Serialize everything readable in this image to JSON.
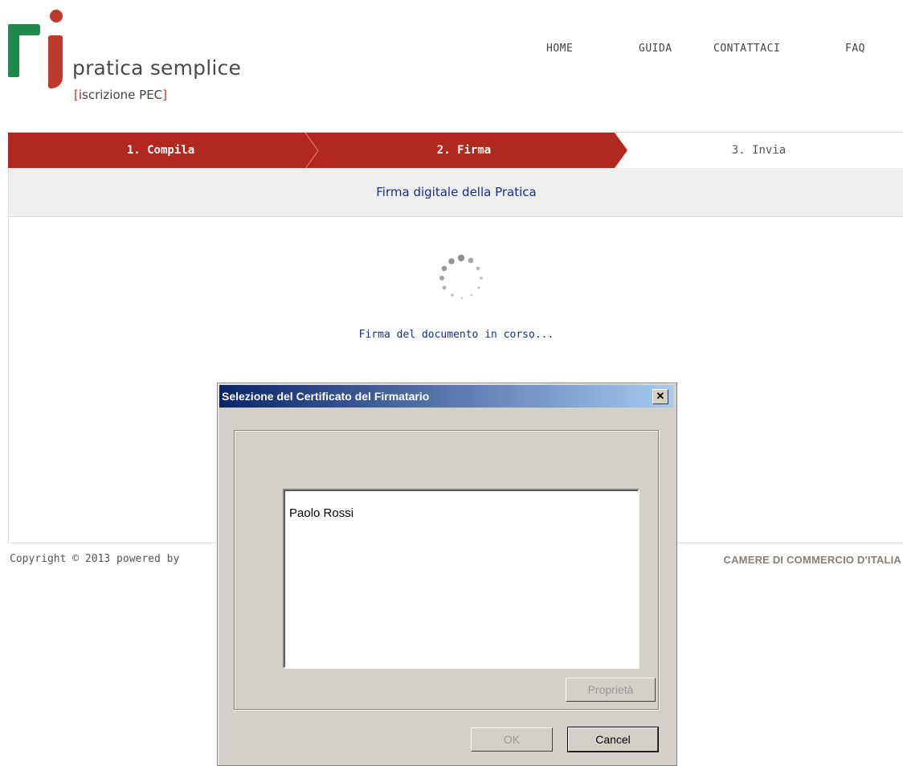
{
  "logo": {
    "name": "pratica semplice",
    "sub_bracket_open": "[",
    "sub_text": "iscrizione PEC",
    "sub_bracket_close": "]"
  },
  "nav": {
    "home": "HOME",
    "guida": "GUIDA",
    "contattaci": "CONTATTACI",
    "faq": "FAQ"
  },
  "steps": [
    {
      "label": "1. Compila"
    },
    {
      "label": "2. Firma"
    },
    {
      "label": "3. Invia"
    }
  ],
  "content": {
    "header": "Firma digitale della Pratica",
    "status": "Firma del documento in corso..."
  },
  "footer": {
    "copyright": "Copyright © 2013 powered by",
    "brand": "CAMERE DI COMMERCIO D'ITALIA"
  },
  "dialog": {
    "title": "Selezione del Certificato  del Firmatario",
    "close": "✕",
    "certificates": [
      "Paolo Rossi"
    ],
    "properties_label": "Proprietà",
    "ok_label": "OK",
    "cancel_label": "Cancel"
  },
  "colors": {
    "brand_red": "#b0281e",
    "brand_green": "#1f8a4c",
    "link_blue": "#1a2b8c"
  }
}
